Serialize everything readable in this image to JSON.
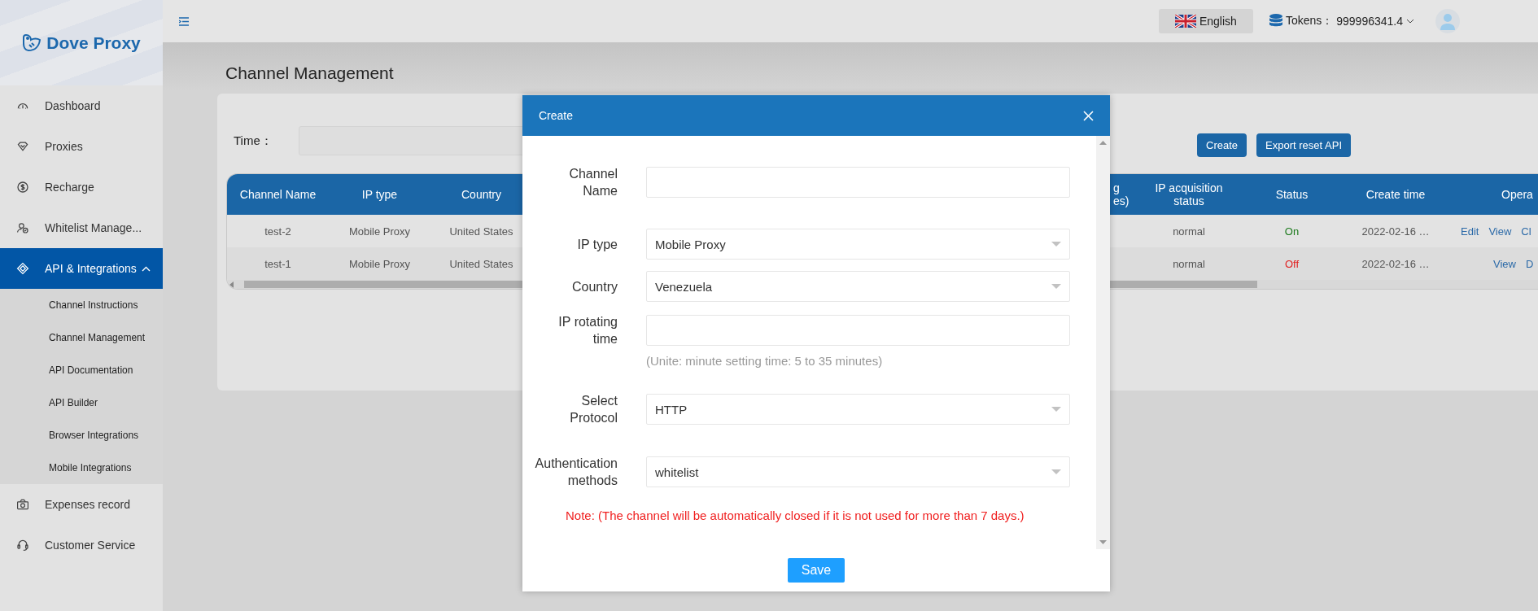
{
  "sidebar": {
    "logo": "Dove Proxy",
    "items": [
      {
        "label": "Dashboard",
        "selected": false
      },
      {
        "label": "Proxies",
        "selected": false
      },
      {
        "label": "Recharge",
        "selected": false
      },
      {
        "label": "Whitelist Manage...",
        "selected": false
      },
      {
        "label": "API & Integrations",
        "selected": true,
        "expanded": true,
        "children": [
          {
            "label": "Channel Instructions"
          },
          {
            "label": "Channel Management"
          },
          {
            "label": "API Documentation"
          },
          {
            "label": "API Builder"
          },
          {
            "label": "Browser Integrations"
          },
          {
            "label": "Mobile Integrations"
          }
        ]
      },
      {
        "label": "Expenses record",
        "selected": false
      },
      {
        "label": "Customer Service",
        "selected": false
      }
    ]
  },
  "header": {
    "language": "English",
    "tokens_label": "Tokens：",
    "tokens_value": "999996341.4"
  },
  "page": {
    "title": "Channel Management",
    "filter_label": "Time：",
    "buttons": [
      "Create",
      "Export reset API"
    ],
    "table": {
      "columns": [
        "Channel Name",
        "IP type",
        "Country",
        "g es)",
        "IP acquisition status",
        "Status",
        "Create time",
        "Opera"
      ],
      "rows": [
        {
          "cells": [
            "test-2",
            "Mobile Proxy",
            "United States",
            "normal"
          ],
          "status": {
            "label": "On",
            "on": true
          },
          "create_time": "2022-02-16 …",
          "actions": [
            "Edit",
            "View",
            "Cl"
          ]
        },
        {
          "cells": [
            "test-1",
            "Mobile Proxy",
            "United States",
            "normal"
          ],
          "status": {
            "label": "Off",
            "on": false
          },
          "create_time": "2022-02-16 …",
          "actions": [
            "View",
            "D"
          ]
        }
      ]
    }
  },
  "modal": {
    "title": "Create",
    "fields": [
      {
        "kind": "text",
        "label": "Channel Name"
      },
      {
        "kind": "select",
        "label": "IP type",
        "value": "Mobile Proxy"
      },
      {
        "kind": "select",
        "label": "Country",
        "value": "Venezuela"
      },
      {
        "kind": "text",
        "label": "IP rotating time",
        "hint": "(Unite: minute setting time: 5 to 35 minutes)"
      },
      {
        "kind": "select",
        "label": "Select Protocol",
        "value": "HTTP"
      },
      {
        "kind": "select",
        "label": "Authentication methods",
        "value": "whitelist"
      }
    ],
    "note": "Note: (The channel will be automatically closed if it is not used for more than 7 days.)",
    "save": "Save"
  }
}
